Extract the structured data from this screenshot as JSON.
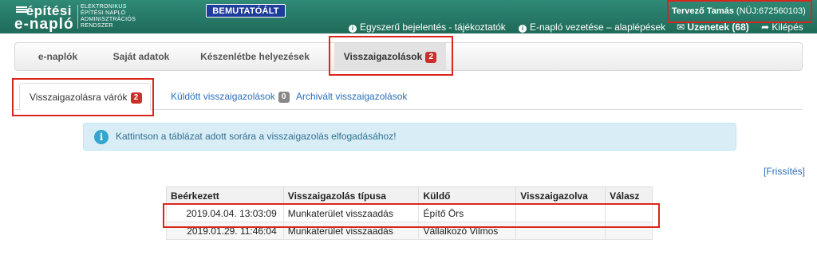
{
  "header": {
    "logo_line1": "építési",
    "logo_line2": "e-napló",
    "logo_sub": [
      "ELEKTRONIKUS",
      "ÉPÍTÉSI NAPLÓ",
      "ADMINISZTRÁCIÓS",
      "RENDSZER"
    ],
    "demo_badge": "BEMUTATÓÁLT",
    "links": [
      {
        "label": "Egyszerű bejelentés - tájékoztatók",
        "icon": "info-icon"
      },
      {
        "label": "E-napló vezetése – alaplépések",
        "icon": "info-icon"
      },
      {
        "label": "Üzenetek (68)",
        "icon": "envelope-icon"
      },
      {
        "label": "Kilépés",
        "icon": "share-arrow-icon"
      }
    ],
    "user_name": "Tervező Tamás",
    "user_id": "(NÜJ:672560103)"
  },
  "nav": {
    "items": [
      {
        "label": "e-naplók"
      },
      {
        "label": "Saját adatok"
      },
      {
        "label": "Készenlétbe helyezések"
      },
      {
        "label": "Visszaigazolások",
        "badge": "2",
        "active": true
      }
    ]
  },
  "subtabs": [
    {
      "label": "Visszaigazolásra várók",
      "badge": "2",
      "active": true
    },
    {
      "label": "Küldött visszaigazolások",
      "badge": "0"
    },
    {
      "label": "Archivált visszaigazolások"
    }
  ],
  "alert": {
    "icon": "info-circle-icon",
    "text": "Kattintson a táblázat adott sorára a visszaigazolás elfogadásához!"
  },
  "refresh_label": "[Frissítés]",
  "table": {
    "headers": [
      "Beérkezett",
      "Visszaigazolás típusa",
      "Küldő",
      "Visszaigazolva",
      "Válasz"
    ],
    "rows": [
      [
        "2019.04.04. 13:03:09",
        "Munkaterület visszaadás",
        "Építő Örs",
        "",
        ""
      ],
      [
        "2019.01.29. 11:46:04",
        "Munkaterület visszaadás",
        "Vállalkozó Vilmos",
        "",
        ""
      ]
    ]
  },
  "colors": {
    "header_green": "#2a7a66",
    "highlight": "#d9261c",
    "badge_red": "#c9302c",
    "link_blue": "#2a6ebb"
  }
}
